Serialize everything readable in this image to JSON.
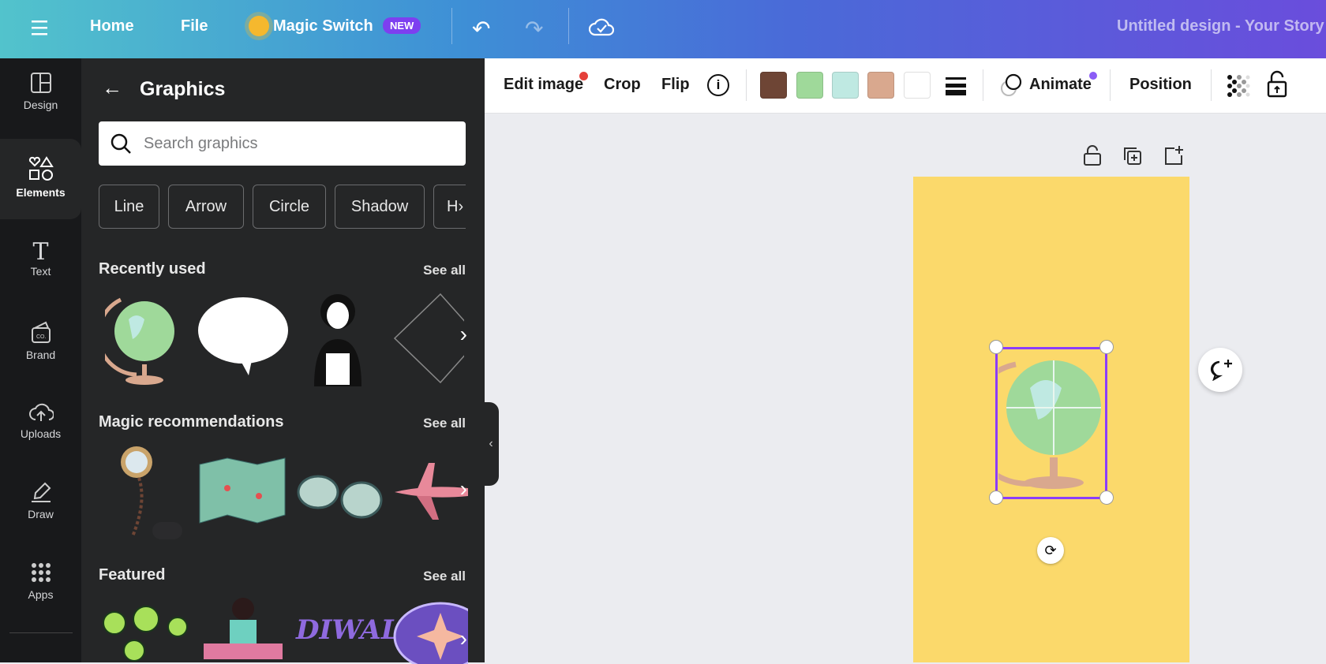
{
  "header": {
    "home": "Home",
    "file": "File",
    "magic_switch": "Magic Switch",
    "new_badge": "NEW",
    "design_title": "Untitled design - Your Story"
  },
  "rail": {
    "items": [
      {
        "label": "Design"
      },
      {
        "label": "Elements"
      },
      {
        "label": "Text"
      },
      {
        "label": "Brand"
      },
      {
        "label": "Uploads"
      },
      {
        "label": "Draw"
      },
      {
        "label": "Apps"
      }
    ]
  },
  "panel": {
    "title": "Graphics",
    "search_placeholder": "Search graphics",
    "chips": [
      "Line",
      "Arrow",
      "Circle",
      "Shadow",
      "H"
    ],
    "sections": [
      {
        "title": "Recently used",
        "see_all": "See all"
      },
      {
        "title": "Magic recommendations",
        "see_all": "See all"
      },
      {
        "title": "Featured",
        "see_all": "See all"
      }
    ],
    "diwali": "DIWALI"
  },
  "toolbar": {
    "edit_image": "Edit image",
    "crop": "Crop",
    "flip": "Flip",
    "animate": "Animate",
    "position": "Position",
    "colors": [
      "#6e4535",
      "#9fd99a",
      "#bfe9e2",
      "#d9a88e",
      "#ffffff"
    ]
  }
}
